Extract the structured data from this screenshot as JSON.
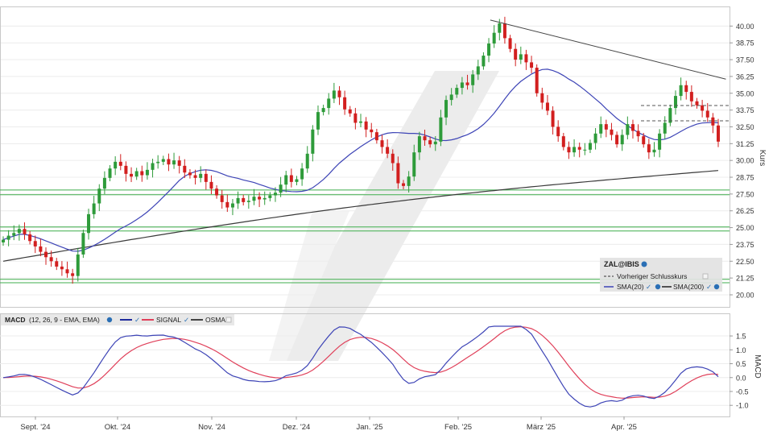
{
  "chart_data": {
    "type": "candlestick",
    "instrument": "ZAL@IBIS",
    "legend": {
      "previous_close": "Vorheriger Schlusskurs",
      "sma20": "SMA(20)",
      "sma200": "SMA(200)"
    },
    "price_axis": {
      "label": "Kurs",
      "ylim": [
        19.1,
        41.4
      ],
      "ticks": [
        "40.00",
        "38.75",
        "37.50",
        "36.25",
        "35.00",
        "33.75",
        "32.50",
        "31.25",
        "30.00",
        "28.75",
        "27.50",
        "26.25",
        "25.00",
        "23.75",
        "22.50",
        "21.25",
        "20.00"
      ]
    },
    "macd_axis": {
      "label": "MACD",
      "ylim": [
        -1.4,
        1.85
      ],
      "ticks": [
        "1.5",
        "1.0",
        "0.5",
        "0.0",
        "-0.5",
        "-1.0"
      ]
    },
    "x_axis": {
      "ticks": [
        "Sept. '24",
        "Okt. '24",
        "Nov. '24",
        "Dez. '24",
        "Jan. '25",
        "Feb. '25",
        "März '25",
        "Apr. '25"
      ]
    },
    "macd_legend": {
      "title": "MACD",
      "params": "(12, 26, 9 - EMA, EMA)",
      "signal": "SIGNAL",
      "osma": "OSMA"
    },
    "horizontal_levels": [
      27.8,
      27.45,
      25.05,
      24.75,
      21.15,
      20.9
    ],
    "trendline": {
      "x": [
        0.672,
        0.995
      ],
      "y": [
        40.45,
        36.05
      ]
    },
    "close": [
      24.1,
      24.4,
      24.6,
      24.9,
      24.5,
      24.0,
      23.6,
      23.2,
      22.8,
      22.5,
      22.1,
      21.9,
      21.6,
      21.4,
      23.0,
      24.6,
      26.0,
      26.8,
      27.9,
      28.7,
      29.4,
      29.9,
      29.6,
      29.0,
      28.8,
      29.2,
      28.9,
      29.3,
      29.8,
      29.9,
      30.1,
      29.7,
      30.0,
      29.6,
      29.1,
      28.9,
      28.7,
      29.0,
      28.4,
      27.9,
      27.4,
      26.9,
      26.5,
      26.8,
      27.2,
      26.9,
      27.0,
      27.3,
      27.1,
      27.2,
      27.4,
      27.6,
      28.2,
      28.9,
      28.4,
      28.6,
      29.4,
      30.5,
      32.3,
      33.6,
      33.9,
      34.6,
      35.2,
      34.7,
      33.8,
      33.5,
      32.8,
      32.9,
      32.3,
      32.1,
      31.5,
      31.0,
      30.5,
      29.8,
      28.3,
      28.1,
      28.8,
      30.6,
      31.8,
      31.5,
      31.2,
      31.4,
      33.2,
      34.5,
      34.9,
      35.4,
      35.8,
      35.6,
      36.4,
      37.0,
      37.8,
      38.7,
      39.5,
      40.2,
      39.1,
      38.3,
      37.5,
      37.9,
      37.3,
      36.9,
      35.0,
      34.3,
      33.7,
      32.5,
      31.8,
      31.0,
      30.6,
      31.0,
      30.8,
      30.8,
      31.3,
      32.0,
      32.7,
      32.3,
      31.9,
      31.2,
      31.9,
      32.7,
      32.2,
      31.8,
      31.2,
      30.6,
      30.8,
      32.0,
      32.8,
      33.9,
      34.8,
      35.6,
      35.1,
      34.4,
      34.1,
      33.7,
      33.2,
      32.6,
      31.4
    ]
  },
  "header_note": ""
}
